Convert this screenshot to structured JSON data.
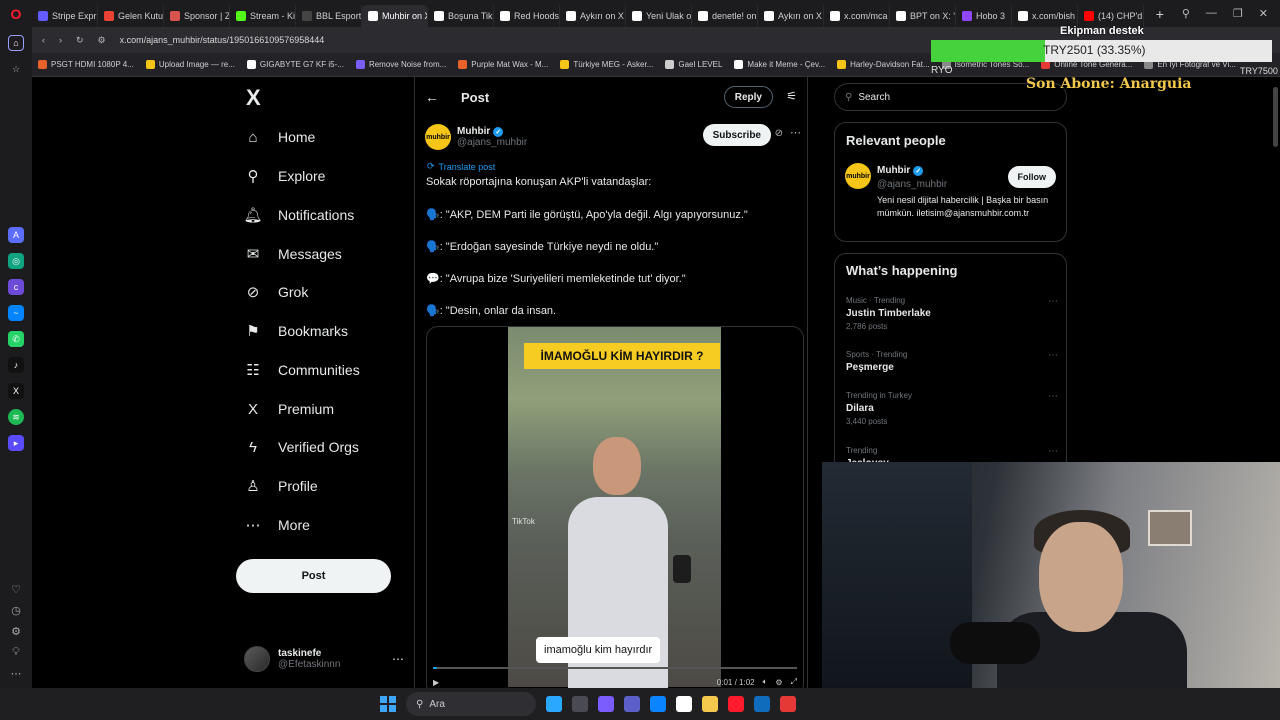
{
  "browser": {
    "tabs": [
      {
        "label": "Stripe Expr",
        "color": "#635bff"
      },
      {
        "label": "Gelen Kutu",
        "color": "#ea4335"
      },
      {
        "label": "Sponsor | Z",
        "color": "#d9534f"
      },
      {
        "label": "Stream - Ki",
        "color": "#53fc18"
      },
      {
        "label": "BBL Esport",
        "color": "#444444"
      },
      {
        "label": "Muhbir on X: \"S",
        "color": "#ffffff",
        "active": true
      },
      {
        "label": "Boşuna Tik",
        "color": "#ffffff"
      },
      {
        "label": "Red Hoods",
        "color": "#ffffff"
      },
      {
        "label": "Aykırı on X",
        "color": "#ffffff"
      },
      {
        "label": "Yeni Ulak o",
        "color": "#ffffff"
      },
      {
        "label": "denetle! on",
        "color": "#ffffff"
      },
      {
        "label": "Aykırı on X",
        "color": "#ffffff"
      },
      {
        "label": "x.com/mca",
        "color": "#ffffff"
      },
      {
        "label": "BPT on X: \"",
        "color": "#ffffff"
      },
      {
        "label": "Hobo 3",
        "color": "#9147ff"
      },
      {
        "label": "x.com/bish",
        "color": "#ffffff"
      },
      {
        "label": "(14) CHP'd",
        "color": "#ff0000"
      }
    ],
    "url": "x.com/ajans_muhbir/status/1950166109576958444",
    "bookmarks": [
      {
        "label": "PSGT HDMI 1080P 4...",
        "color": "#e8622c"
      },
      {
        "label": "Upload Image — re...",
        "color": "#f5c518"
      },
      {
        "label": "GIGABYTE G7 KF i5-...",
        "color": "#ffffff"
      },
      {
        "label": "Remove Noise from...",
        "color": "#7b5cff"
      },
      {
        "label": "Purple Mat Wax - M...",
        "color": "#e8622c"
      },
      {
        "label": "Türkiye MEG - Asker...",
        "color": "#f5c518"
      },
      {
        "label": "Gael LEVEL",
        "color": "#cccccc"
      },
      {
        "label": "Make it Meme - Çev...",
        "color": "#ffffff"
      },
      {
        "label": "Harley-Davidson Fat...",
        "color": "#f5c518"
      },
      {
        "label": "Isometric Tones So...",
        "color": "#888888"
      },
      {
        "label": "Online Tone Genera...",
        "color": "#e53935"
      },
      {
        "label": "En İyi Fotoğraf ve Vi...",
        "color": "#888888"
      }
    ]
  },
  "nav": {
    "logo": "X",
    "items": [
      {
        "label": "Home",
        "icon": "⌂",
        "icon_name": "home-icon"
      },
      {
        "label": "Explore",
        "icon": "⚲",
        "icon_name": "search-icon"
      },
      {
        "label": "Notifications",
        "icon": "🔔︎",
        "icon_name": "bell-icon"
      },
      {
        "label": "Messages",
        "icon": "✉",
        "icon_name": "mail-icon"
      },
      {
        "label": "Grok",
        "icon": "⊘",
        "icon_name": "grok-icon"
      },
      {
        "label": "Bookmarks",
        "icon": "⚑",
        "icon_name": "bookmark-icon"
      },
      {
        "label": "Communities",
        "icon": "☷",
        "icon_name": "communities-icon"
      },
      {
        "label": "Premium",
        "icon": "X",
        "icon_name": "premium-icon"
      },
      {
        "label": "Verified Orgs",
        "icon": "ϟ",
        "icon_name": "lightning-icon"
      },
      {
        "label": "Profile",
        "icon": "♙",
        "icon_name": "profile-icon"
      },
      {
        "label": "More",
        "icon": "⋯",
        "icon_name": "more-icon"
      }
    ],
    "post_label": "Post",
    "user": {
      "name": "taskinefe",
      "handle": "@Efetaskinnn"
    }
  },
  "main": {
    "title": "Post",
    "reply_label": "Reply",
    "author": {
      "name": "Muhbir",
      "handle": "@ajans_muhbir",
      "avatar_text": "muhbir"
    },
    "subscribe_label": "Subscribe",
    "translate_label": "Translate post",
    "lines": [
      "Sokak röportajına konuşan AKP'li vatandaşlar:",
      "🗣️: \"AKP, DEM Parti ile görüştü, Apo'yla değil. Algı yapıyorsunuz.\"",
      "🗣️: \"Erdoğan sayesinde Türkiye neydi ne oldu.\"",
      "💬: \"Avrupa bize 'Suriyelileri memleketinde tut' diyor.\"",
      "🗣️: \"Desin, onlar da insan."
    ],
    "video": {
      "banner": "İMAMOĞLU KİM HAYIRDIR ?",
      "caption": "imamoğlu kim hayırdır",
      "watermark": "TikTok",
      "time": "0:01 / 1:02",
      "progress": 0.01
    }
  },
  "right": {
    "search_placeholder": "Search",
    "relevant_title": "Relevant people",
    "person": {
      "name": "Muhbir",
      "handle": "@ajans_muhbir",
      "follow_label": "Follow",
      "bio": "Yeni nesil dijital habercilik | Başka bir basın mümkün. iletisim@ajansmuhbir.com.tr"
    },
    "happening_title": "What’s happening",
    "trends": [
      {
        "meta": "Music · Trending",
        "name": "Justin Timberlake",
        "count": "2,786 posts"
      },
      {
        "meta": "Sports · Trending",
        "name": "Peşmerge",
        "count": ""
      },
      {
        "meta": "Trending in Turkey",
        "name": "Dilara",
        "count": "3,440 posts"
      },
      {
        "meta": "Trending",
        "name": "Jealousy",
        "count": ""
      }
    ]
  },
  "overlay": {
    "title": "Ekipman destek",
    "progress_label": "TRY2501 (33.35%)",
    "progress": 0.3335,
    "left_label": "RYO",
    "right_label": "TRY7500",
    "sub_text": "Son Abone: Anarguia"
  },
  "taskbar": {
    "search_label": "Ara",
    "apps": [
      "#2aa8ff",
      "#4a4a52",
      "#7b5cff",
      "#5b5fc7",
      "#0a84ff",
      "#ffffff",
      "#f2c94c",
      "#ff1b2d",
      "#0f6cbd",
      "#e53935"
    ]
  }
}
